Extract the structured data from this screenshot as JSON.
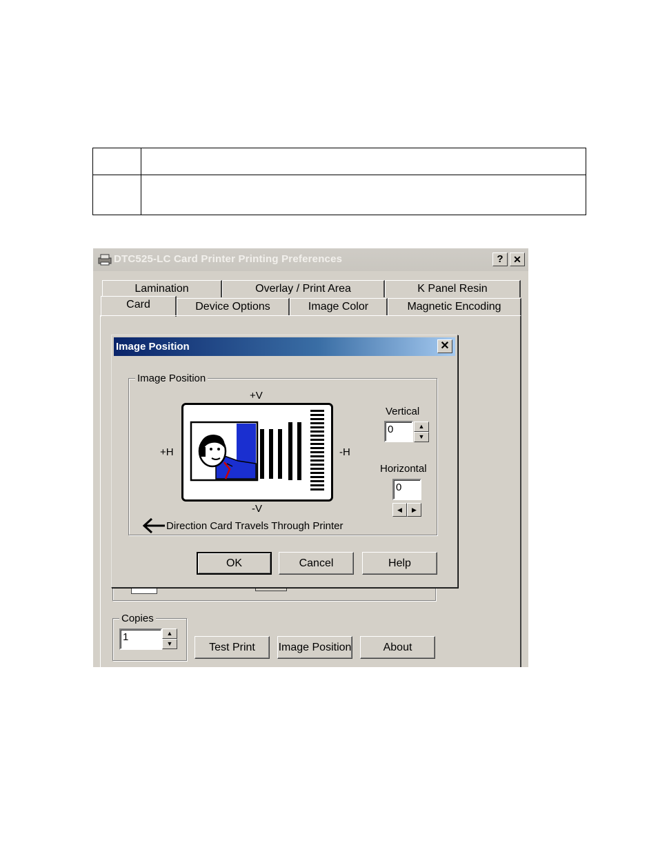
{
  "window": {
    "title": "DTC525-LC Card Printer Printing Preferences",
    "help_button": "?",
    "close_button": "✕"
  },
  "tabs": {
    "row_back": [
      "Lamination",
      "Overlay / Print Area",
      "K Panel Resin"
    ],
    "row_front": [
      "Card",
      "Device Options",
      "Image Color",
      "Magnetic Encoding"
    ],
    "active": "Card"
  },
  "copies": {
    "label": "Copies",
    "value": "1"
  },
  "bottom_buttons": {
    "test_print": "Test Print",
    "image_position": "Image Position",
    "about": "About"
  },
  "dialog": {
    "title": "Image Position",
    "close_button": "✕",
    "group_label": "Image Position",
    "plus_v": "+V",
    "minus_v": "-V",
    "plus_h": "+H",
    "minus_h": "-H",
    "direction_text": "Direction Card Travels Through Printer",
    "vertical_label": "Vertical",
    "vertical_value": "0",
    "horizontal_label": "Horizontal",
    "horizontal_value": "0",
    "ok": "OK",
    "cancel": "Cancel",
    "help": "Help"
  },
  "icons": {
    "printer": "printer-icon",
    "arrow_left": "arrow-left-icon",
    "spin_up": "spin-up-icon",
    "spin_down": "spin-down-icon",
    "spin_left": "spin-left-icon",
    "spin_right": "spin-right-icon"
  },
  "colors": {
    "dialog_title_start": "#0a246a",
    "dialog_title_end": "#a6caf0",
    "card_jacket": "#1a2fd0",
    "face": "#d4d0c8"
  }
}
